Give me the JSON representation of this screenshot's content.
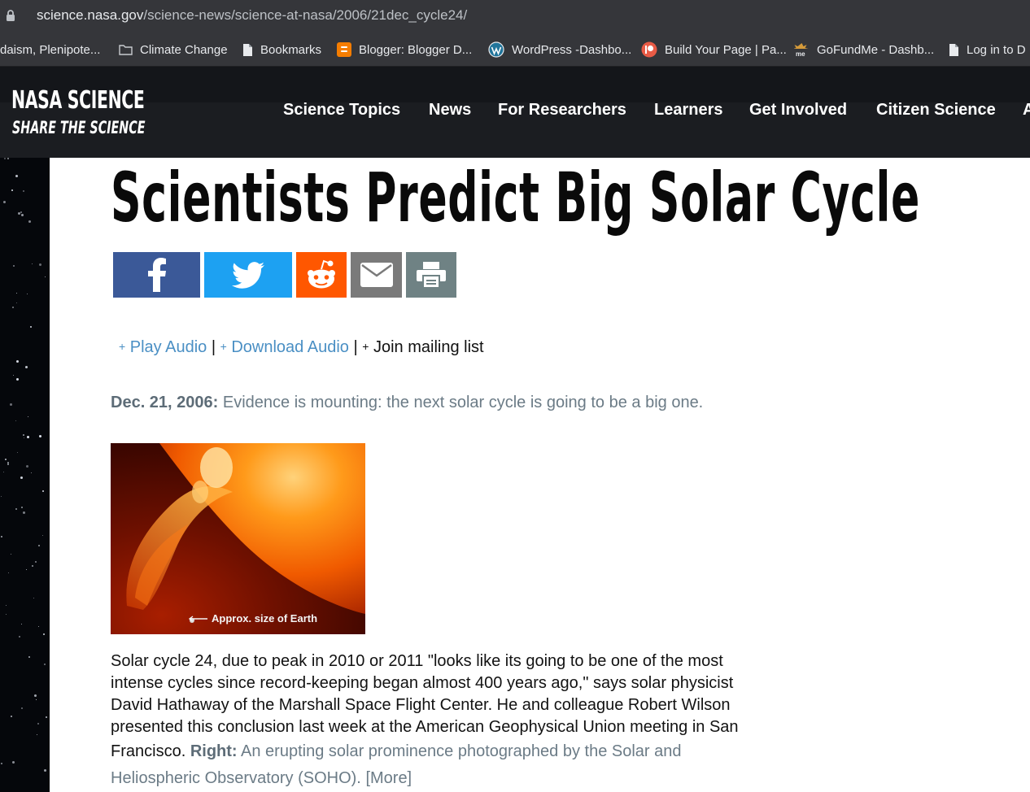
{
  "browser": {
    "url_host": "science.nasa.gov",
    "url_path": "/science-news/science-at-nasa/2006/21dec_cycle24/",
    "bookmarks": [
      {
        "label": "daism, Plenipote...",
        "icon": "none"
      },
      {
        "label": "Climate Change",
        "icon": "folder-icon"
      },
      {
        "label": "Bookmarks",
        "icon": "page-icon"
      },
      {
        "label": "Blogger: Blogger D...",
        "icon": "blogger-icon"
      },
      {
        "label": "WordPress -Dashbo...",
        "icon": "wordpress-icon"
      },
      {
        "label": "Build Your Page | Pa...",
        "icon": "patreon-icon"
      },
      {
        "label": "GoFundMe - Dashb...",
        "icon": "gofundme-icon"
      },
      {
        "label": "Log in to D",
        "icon": "page-icon"
      }
    ]
  },
  "site": {
    "logo_line1": "NASA SCIENCE",
    "logo_line2": "SHARE THE SCIENCE",
    "nav": [
      "Science Topics",
      "News",
      "For Researchers",
      "Learners",
      "Get Involved",
      "Citizen Science",
      "A"
    ]
  },
  "article": {
    "title": "Scientists Predict Big Solar Cycle",
    "share": {
      "facebook_color": "#3b5998",
      "twitter_color": "#1da1f2",
      "reddit_color": "#ff5700",
      "email_color": "#7a7a7a",
      "print_color": "#6f8284"
    },
    "audio": {
      "play": "Play Audio",
      "download": "Download Audio",
      "mailing": "Join mailing list",
      "sep": "|",
      "plus": "+"
    },
    "date": "Dec. 21, 2006:",
    "lede": "Evidence is mounting: the next solar cycle is going to be a big one.",
    "photo_caption": "Approx. size of Earth",
    "body_lines": [
      "Solar cycle 24, due to peak in 2010 or 2011 \"looks like its going to be one of the most",
      "intense cycles since record-keeping began almost 400 years ago,\" says solar physicist",
      "David Hathaway of the Marshall Space Flight Center. He and colleague Robert Wilson",
      "presented this conclusion last week at the American Geophysical Union meeting in San"
    ],
    "body_last": "Francisco.",
    "caption_label": "Right:",
    "caption_text_1": "An erupting solar prominence photographed by the Solar and",
    "caption_text_2": "Heliospheric Observatory (SOHO).",
    "more": "[More]"
  }
}
